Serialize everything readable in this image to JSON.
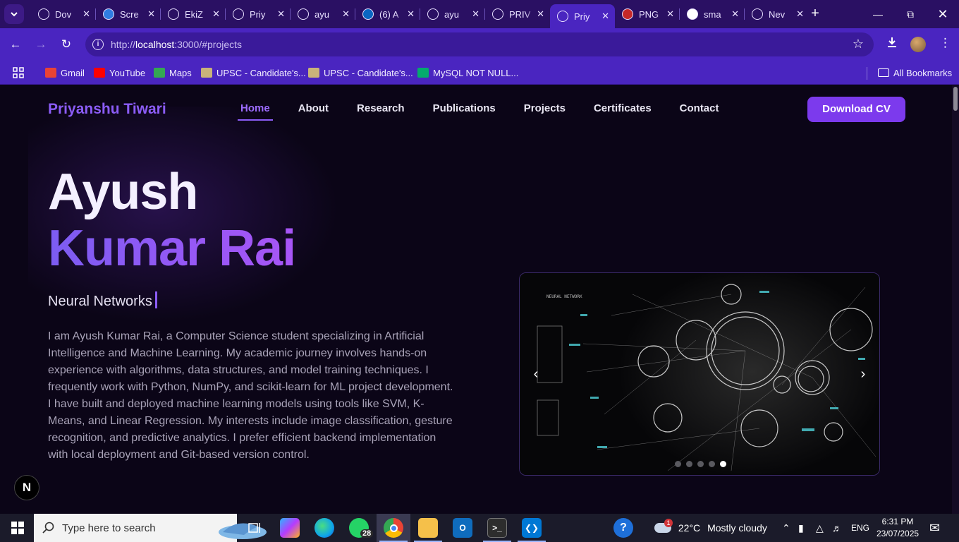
{
  "browser": {
    "tabs": [
      {
        "title": "Dov",
        "favicon": "openai-icon",
        "color": "#2a1063"
      },
      {
        "title": "Scre",
        "favicon": "screen-icon",
        "color": "#2f7de1"
      },
      {
        "title": "EkiZ",
        "favicon": "github-icon",
        "color": "#2a1063"
      },
      {
        "title": "Priy",
        "favicon": "globe-icon",
        "color": "#2a1063"
      },
      {
        "title": "ayu",
        "favicon": "github-icon",
        "color": "#2a1063"
      },
      {
        "title": "(6) A",
        "favicon": "linkedin-icon",
        "color": "#0a66c2"
      },
      {
        "title": "ayu",
        "favicon": "github-icon",
        "color": "#2a1063"
      },
      {
        "title": "PRIV",
        "favicon": "github-icon",
        "color": "#2a1063"
      },
      {
        "title": "Priy",
        "favicon": "globe-icon",
        "color": "#4a25c0"
      },
      {
        "title": "PNG",
        "favicon": "png-jpg-icon",
        "color": "#c62828"
      },
      {
        "title": "sma",
        "favicon": "google-icon",
        "color": "#ffffff"
      },
      {
        "title": "Nev",
        "favicon": "chrome-icon",
        "color": "#2a1063"
      }
    ],
    "active_tab_index": 8,
    "url_prefix": "http://",
    "url_host": "localhost",
    "url_rest": ":3000/#projects",
    "bookmarks": [
      {
        "label": "Gmail",
        "icon": "gmail-icon",
        "color": "#ea4335"
      },
      {
        "label": "YouTube",
        "icon": "youtube-icon",
        "color": "#ff0000"
      },
      {
        "label": "Maps",
        "icon": "maps-icon",
        "color": "#34a853"
      },
      {
        "label": "UPSC - Candidate's...",
        "icon": "upsc-icon",
        "color": "#c9b27a"
      },
      {
        "label": "UPSC - Candidate's...",
        "icon": "upsc-icon",
        "color": "#c9b27a"
      },
      {
        "label": "MySQL NOT NULL...",
        "icon": "w3schools-icon",
        "color": "#04aa6d"
      }
    ],
    "all_bookmarks": "All Bookmarks"
  },
  "site": {
    "brand": "Priyanshu Tiwari",
    "nav": [
      "Home",
      "About",
      "Research",
      "Publications",
      "Projects",
      "Certificates",
      "Contact"
    ],
    "active_nav": "Home",
    "download_cv": "Download CV",
    "hero_first": "Ayush",
    "hero_last": "Kumar Rai",
    "typed_text": "Neural Networks",
    "bio": "I am Ayush Kumar Rai, a Computer Science student specializing in Artificial Intelligence and Machine Learning. My academic journey involves hands-on experience with algorithms, data structures, and model training techniques. I frequently work with Python, NumPy, and scikit-learn for ML project development. I have built and deployed machine learning models using tools like SVM, K-Means, and Linear Regression. My interests include image classification, gesture recognition, and predictive analytics. I prefer efficient backend implementation with local deployment and Git-based version control.",
    "carousel": {
      "slides": 5,
      "active_slide": 5,
      "prev_glyph": "‹",
      "next_glyph": "›"
    },
    "next_badge": "N"
  },
  "taskbar": {
    "search_placeholder": "Type here to search",
    "whatsapp_badge": "28",
    "weather_temp": "22°C",
    "weather_text": "Mostly cloudy",
    "weather_alert": "1",
    "language": "ENG",
    "time": "6:31 PM",
    "date": "23/07/2025"
  }
}
